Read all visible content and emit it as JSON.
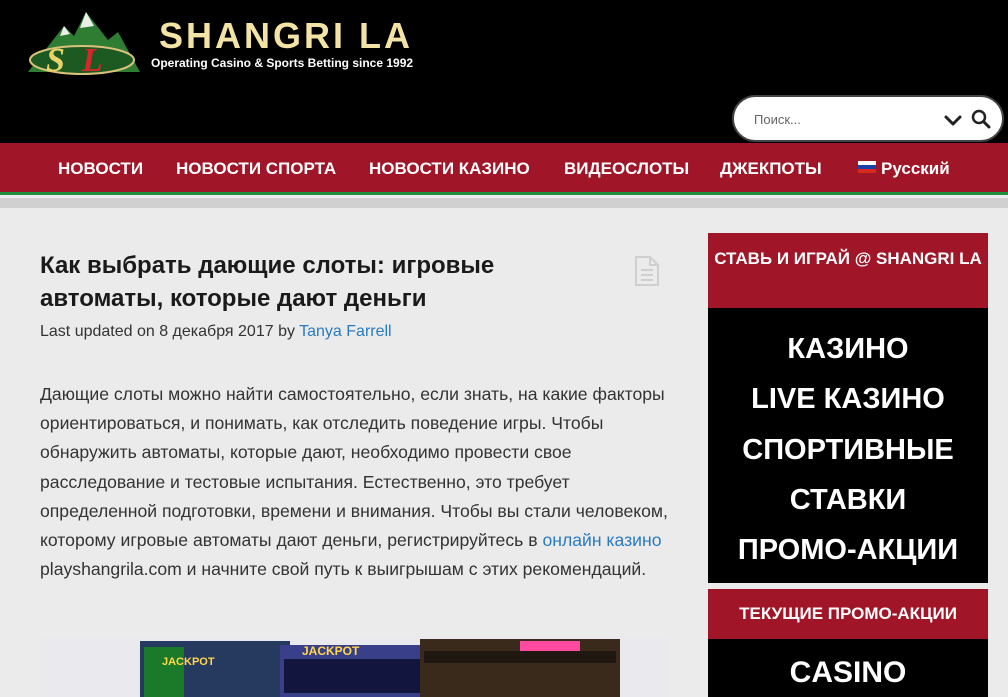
{
  "brand": {
    "title": "SHANGRI LA",
    "tagline": "Operating Casino & Sports Betting since 1992"
  },
  "search": {
    "placeholder": "Поиск..."
  },
  "nav": {
    "items": [
      "НОВОСТИ",
      "НОВОСТИ СПОРТА",
      "НОВОСТИ КАЗИНО",
      "ВИДЕОСЛОТЫ",
      "ДЖЕКПОТЫ"
    ],
    "language": "Русский"
  },
  "article": {
    "title": "Как выбрать дающие слоты: игровые автоматы, которые дают деньги",
    "meta_prefix": "Last updated on 8 декабря 2017 by ",
    "author": "Tanya Farrell",
    "body_start": "Дающие слоты можно найти самостоятельно, если знать, на какие факторы ориентироваться, и понимать, как отследить поведение игры. Чтобы обнаружить автоматы, которые дают, необходимо провести свое расследование и тестовые испытания. Естественно, это требует определенной подготовки, времени и внимания. Чтобы вы стали человеком, которому игровые автоматы дают деньги, регистрируйтесь в ",
    "body_link": "онлайн казино",
    "body_end": " playshangrila.com и начните свой путь к выигрышам с этих рекомендаций.",
    "image_labels": [
      "JACKPOT",
      "JACKPOT"
    ]
  },
  "sidebar": {
    "promo_heading": "СТАВЬ И ИГРАЙ @ SHANGRI LA",
    "promo_links": [
      "КАЗИНО",
      "LIVE КАЗИНО",
      "СПОРТИВНЫЕ СТАВКИ",
      "ПРОМО-АКЦИИ"
    ],
    "current_heading": "ТЕКУЩИЕ ПРОМО-АКЦИИ",
    "current_item": "CASINO"
  },
  "colors": {
    "nav_red": "#a01628",
    "nav_green_border": "#1e8f3c",
    "link_blue": "#2a7ac0",
    "logo_gold": "#f3e3a4"
  },
  "icons": [
    "logo-emblem-icon",
    "chevron-down-icon",
    "search-icon",
    "russian-flag-icon",
    "document-icon"
  ]
}
